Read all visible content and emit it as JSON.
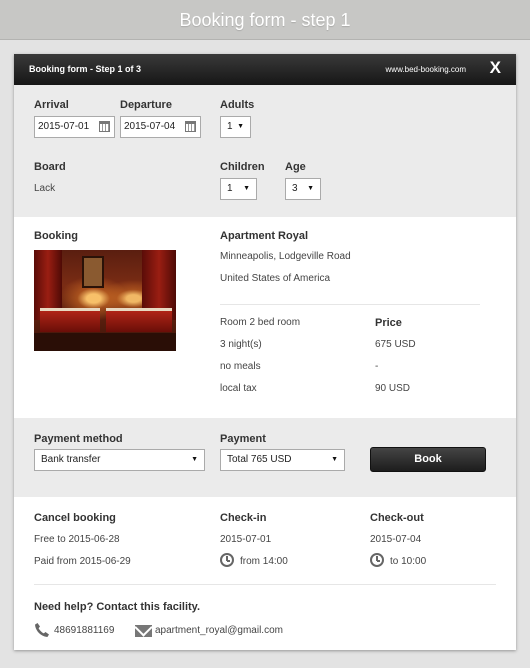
{
  "page": {
    "title": "Booking form - step 1"
  },
  "modal": {
    "title": "Booking form - Step 1 of 3",
    "site": "www.bed-booking.com",
    "close_label": "X"
  },
  "dates": {
    "arrival_label": "Arrival",
    "arrival_value": "2015-07-01",
    "departure_label": "Departure",
    "departure_value": "2015-07-04",
    "adults_label": "Adults",
    "adults_value": "1",
    "board_label": "Board",
    "board_value": "Lack",
    "children_label": "Children",
    "children_value": "1",
    "age_label": "Age",
    "age_value": "3"
  },
  "booking": {
    "heading": "Booking",
    "property_name": "Apartment Royal",
    "address_line1": "Minneapolis, Lodgeville Road",
    "address_line2": "United States of America",
    "price_heading": "Price",
    "lines": [
      {
        "item": "Room 2 bed room",
        "price": ""
      },
      {
        "item": "3 night(s)",
        "price": "675 USD"
      },
      {
        "item": "no meals",
        "price": "-"
      },
      {
        "item": "local tax",
        "price": "90 USD"
      }
    ]
  },
  "payment": {
    "method_label": "Payment method",
    "method_value": "Bank transfer",
    "payment_label": "Payment",
    "payment_value": "Total 765 USD",
    "book_label": "Book"
  },
  "cancel": {
    "heading": "Cancel booking",
    "free_text": "Free to 2015-06-28",
    "paid_text": "Paid from 2015-06-29",
    "checkin_label": "Check-in",
    "checkin_date": "2015-07-01",
    "checkin_time": "from 14:00",
    "checkout_label": "Check-out",
    "checkout_date": "2015-07-04",
    "checkout_time": "to 10:00"
  },
  "contact": {
    "heading": "Need help? Contact this facility.",
    "phone": "48691881169",
    "email": "apartment_royal@gmail.com"
  },
  "icons": [
    "calendar-icon",
    "chevron-down-icon",
    "clock-icon",
    "phone-icon",
    "mail-icon",
    "close-icon"
  ]
}
